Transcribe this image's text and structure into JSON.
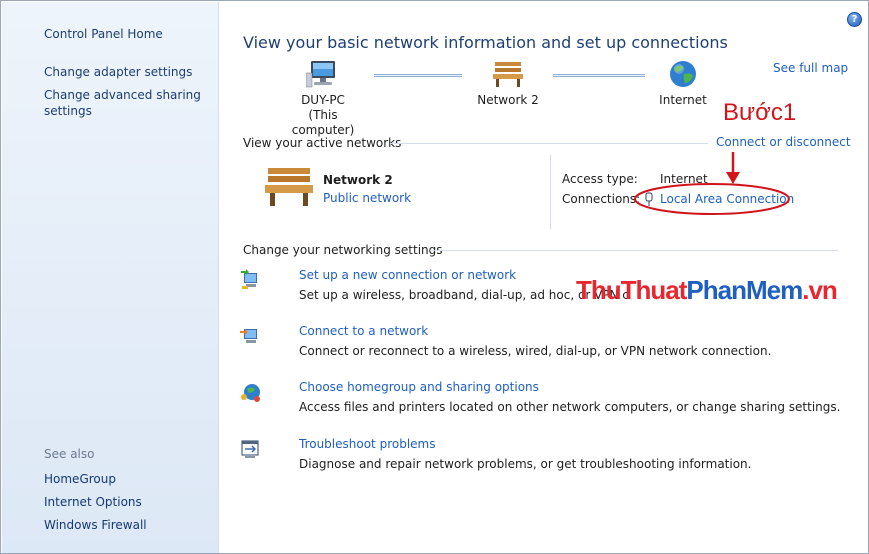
{
  "sidebar": {
    "home": "Control Panel Home",
    "adapter": "Change adapter settings",
    "sharing": "Change advanced sharing settings",
    "see_also": "See also",
    "homegroup": "HomeGroup",
    "internet_options": "Internet Options",
    "firewall": "Windows Firewall"
  },
  "main": {
    "title": "View your basic network information and set up connections",
    "see_full_map": "See full map",
    "map": {
      "computer_name": "DUY-PC",
      "computer_sub": "(This computer)",
      "network_name": "Network 2",
      "internet": "Internet"
    },
    "active_header": "View your active networks",
    "connect_disconnect": "Connect or disconnect",
    "active": {
      "name": "Network 2",
      "type_link": "Public network",
      "access_type_label": "Access type:",
      "access_type_value": "Internet",
      "connections_label": "Connections:",
      "connections_value": "Local Area Connection"
    },
    "settings_header": "Change your networking settings",
    "tasks": [
      {
        "title": "Set up a new connection or network",
        "desc": "Set up a wireless, broadband, dial-up, ad hoc, or VPN c"
      },
      {
        "title": "Connect to a network",
        "desc": "Connect or reconnect to a wireless, wired, dial-up, or VPN network connection."
      },
      {
        "title": "Choose homegroup and sharing options",
        "desc": "Access files and printers located on other network computers, or change sharing settings."
      },
      {
        "title": "Troubleshoot problems",
        "desc": "Diagnose and repair network problems, or get troubleshooting information."
      }
    ]
  },
  "annotation": {
    "step_label": "Bước1"
  },
  "watermark": {
    "part1": "ThuThuat",
    "part2": "PhanMem",
    "part3": ".vn"
  },
  "colors": {
    "link": "#1f5fbf",
    "annotation": "#d1141b",
    "sidebar_bg": "#e3ecf8"
  }
}
